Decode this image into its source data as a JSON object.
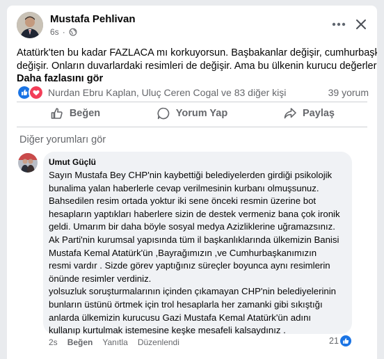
{
  "post": {
    "author": "Mustafa Pehlivan",
    "time": "6s",
    "text_lines": [
      "Atatürk'ten bu kadar FAZLACA mı korkuyorsun. Başbakanlar değişir, cumhurbaşkanları",
      "değişir. Onların duvarlardaki resimleri de değişir. Ama bu ülkenin kurucu değerlerini..."
    ],
    "see_more": "Daha fazlasını gör",
    "reactions_names": "Nurdan Ebru Kaplan, Uluç Ceren Cogal ve 83 diğer kişi",
    "comment_count": "39 yorum"
  },
  "actions": {
    "like": "Beğen",
    "comment": "Yorum Yap",
    "share": "Paylaş"
  },
  "other_comments": "Diğer yorumları gör",
  "comment": {
    "author": "Umut Güçlü",
    "lines": [
      "Sayın Mustafa Bey CHP'nin kaybettiği belediyelerden girdiği psikolojik",
      "bunalima yalan haberlerle cevap verilmesinin kurbanı olmuşsunuz.",
      "Bahsedilen resim ortada yoktur iki sene önceki resmin üzerine bot",
      "hesapların yaptıkları haberlere sizin de destek vermeniz bana çok ironik",
      "geldi. Umarım bir daha böyle sosyal medya Azizliklerine uğramazsınız.",
      "Ak Parti'nin kurumsal yapısında tüm il başkanlıklarında ülkemizin Banisi",
      "Mustafa Kemal Atatürk'ün ,Bayrağımızın ,ve Cumhurbaşkanımızın",
      "resmi vardır . Sizde görev yaptığınız süreçler boyunca aynı resimlerin",
      "önünde resimler verdiniz.",
      "yolsuzluk soruşturmalarının içinden çıkamayan CHP'nin belediyelerinin",
      "bunların üstünü örtmek için trol hesaplarla her zamanki gibi sıkıştığı",
      "anlarda ülkemizin kurucusu Gazi Mustafa Kemal Atatürk'ün adını",
      "kullanıp kurtulmak istemesine keşke mesafeli kalsaydınız ."
    ],
    "time": "2s",
    "like": "Beğen",
    "reply": "Yanıtla",
    "edit": "Düzenlendi",
    "like_count": "21"
  },
  "colors": {
    "like_blue": "#1b74e4",
    "love_red": "#f33e58",
    "muted_text": "#65676b"
  }
}
